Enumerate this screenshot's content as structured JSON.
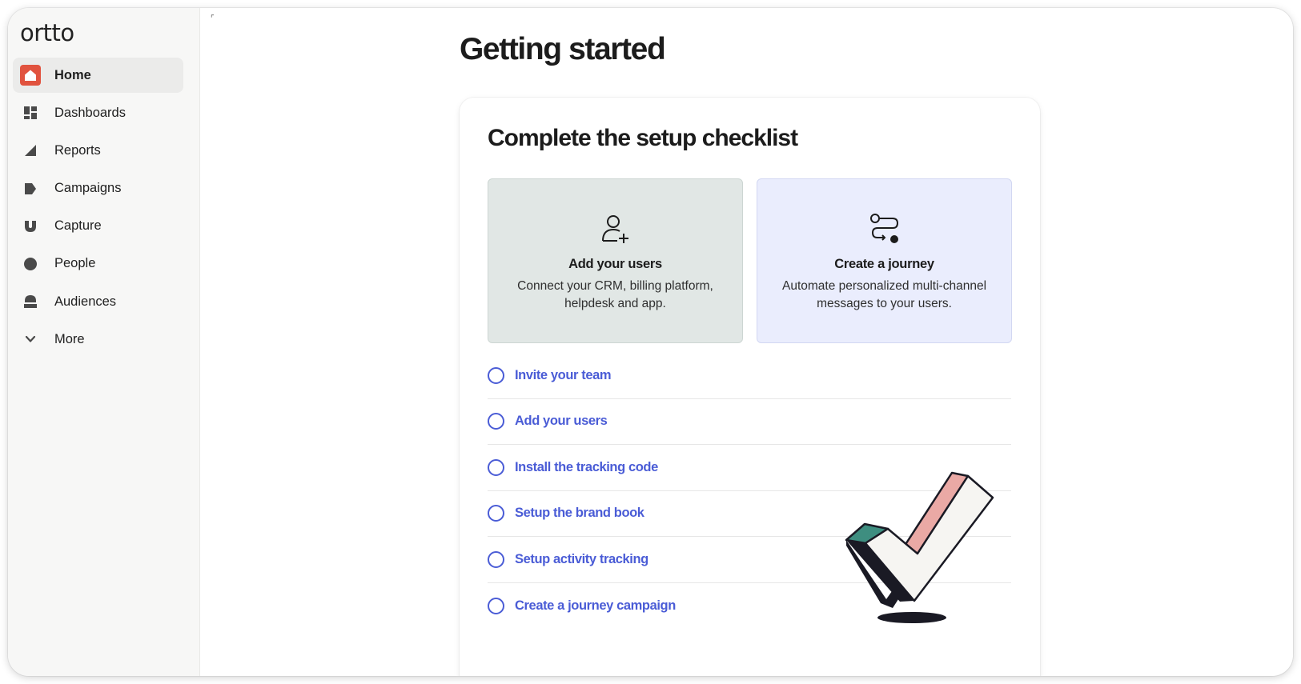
{
  "brand": {
    "logo_text": "ortto",
    "accent": "#e1533f",
    "link_color": "#4a5cd6"
  },
  "sidebar": {
    "items": [
      {
        "label": "Home",
        "icon": "home-icon",
        "active": true
      },
      {
        "label": "Dashboards",
        "icon": "dashboards-icon"
      },
      {
        "label": "Reports",
        "icon": "reports-icon"
      },
      {
        "label": "Campaigns",
        "icon": "campaigns-icon"
      },
      {
        "label": "Capture",
        "icon": "capture-icon"
      },
      {
        "label": "People",
        "icon": "people-icon"
      },
      {
        "label": "Audiences",
        "icon": "audiences-icon"
      },
      {
        "label": "More",
        "icon": "chevron-down-icon"
      }
    ]
  },
  "main": {
    "page_title": "Getting started",
    "card_title": "Complete the setup checklist",
    "tiles": [
      {
        "title": "Add your users",
        "description": "Connect your CRM, billing platform, helpdesk and app.",
        "icon": "add-user-icon"
      },
      {
        "title": "Create a journey",
        "description": "Automate personalized multi-channel messages to your users.",
        "icon": "journey-icon"
      }
    ],
    "checklist": [
      "Invite your team",
      "Add your users",
      "Install the tracking code",
      "Setup the brand book",
      "Setup activity tracking",
      "Create a journey campaign"
    ]
  }
}
